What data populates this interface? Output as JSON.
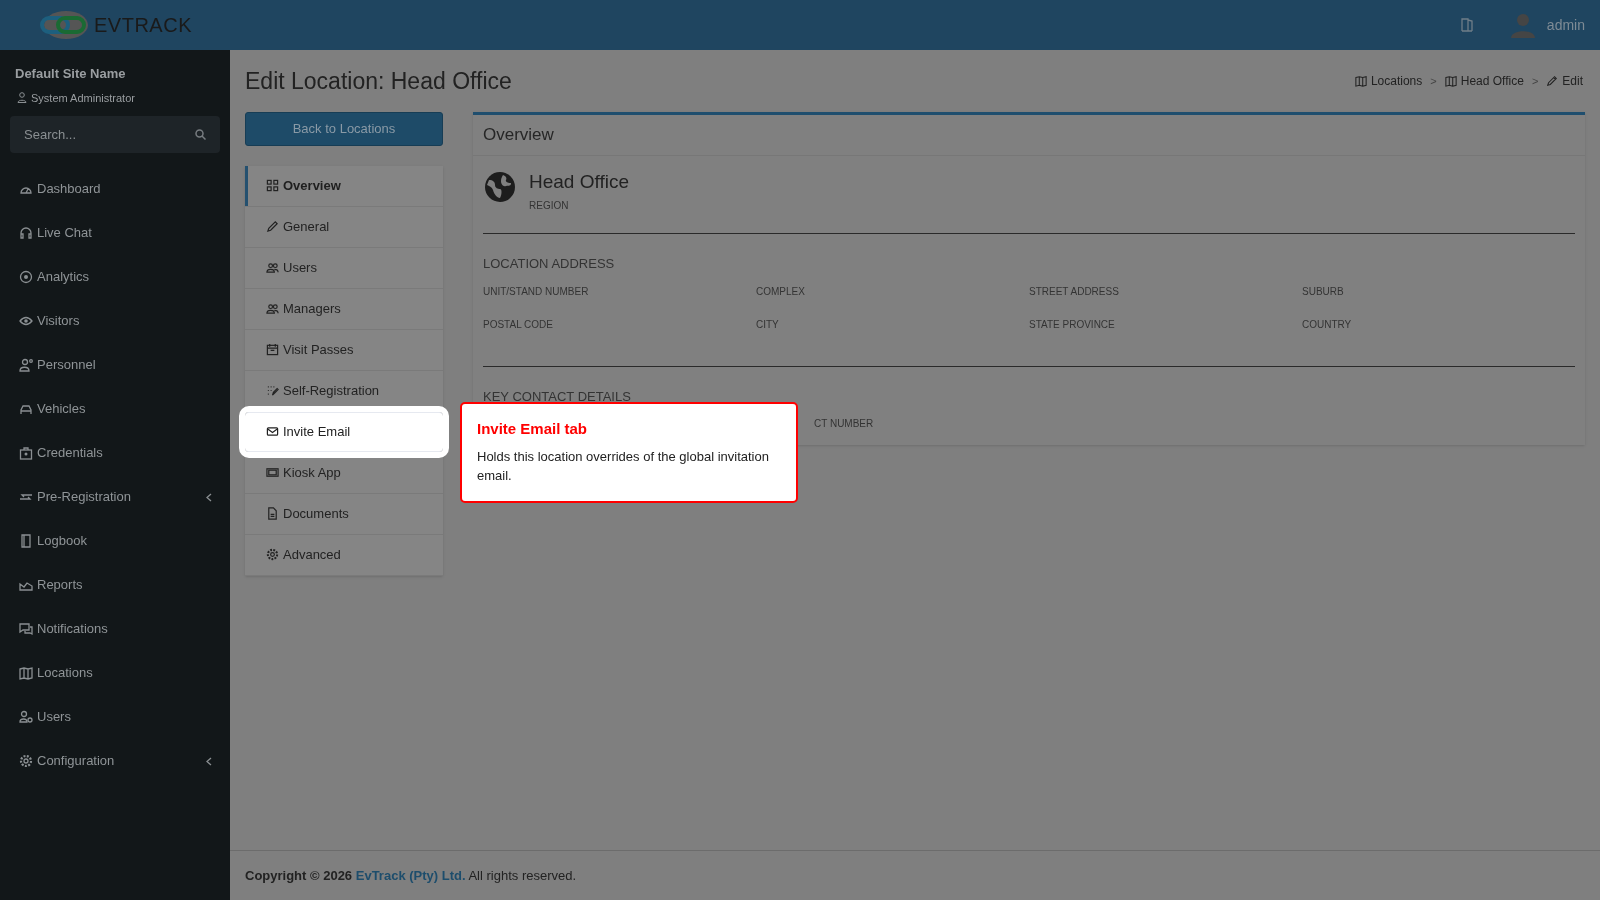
{
  "header": {
    "logo": "**EV**TRACK",
    "user": "admin"
  },
  "sidebar": {
    "site_name": "Default Site Name",
    "role": "System Administrator",
    "search_placeholder": "Search...",
    "items": [
      {
        "label": "Dashboard",
        "expandable": false
      },
      {
        "label": "Live Chat",
        "expandable": false
      },
      {
        "label": "Analytics",
        "expandable": false
      },
      {
        "label": "Visitors",
        "expandable": false
      },
      {
        "label": "Personnel",
        "expandable": false
      },
      {
        "label": "Vehicles",
        "expandable": false
      },
      {
        "label": "Credentials",
        "expandable": false
      },
      {
        "label": "Pre-Registration",
        "expandable": true
      },
      {
        "label": "Logbook",
        "expandable": false
      },
      {
        "label": "Reports",
        "expandable": false
      },
      {
        "label": "Notifications",
        "expandable": false
      },
      {
        "label": "Locations",
        "expandable": false
      },
      {
        "label": "Users",
        "expandable": false
      },
      {
        "label": "Configuration",
        "expandable": true
      }
    ]
  },
  "page": {
    "title": "Edit Location: Head Office",
    "back_button": "Back to Locations",
    "breadcrumbs": [
      {
        "label": "Locations",
        "kind": "map"
      },
      {
        "label": "Head Office",
        "kind": "map",
        "separator": ">"
      },
      {
        "label": "Edit",
        "kind": "pencil",
        "separator": ">"
      }
    ]
  },
  "tabs": [
    {
      "label": "Overview",
      "selected": true,
      "highlighted": false
    },
    {
      "label": "General",
      "selected": false,
      "highlighted": false
    },
    {
      "label": "Users",
      "selected": false,
      "highlighted": false
    },
    {
      "label": "Managers",
      "selected": false,
      "highlighted": false
    },
    {
      "label": "Visit Passes",
      "selected": false,
      "highlighted": false
    },
    {
      "label": "Self-Registration",
      "selected": false,
      "highlighted": false
    },
    {
      "label": "Invite Email",
      "selected": false,
      "highlighted": true
    },
    {
      "label": "Kiosk App",
      "selected": false,
      "highlighted": false
    },
    {
      "label": "Documents",
      "selected": false,
      "highlighted": false
    },
    {
      "label": "Advanced",
      "selected": false,
      "highlighted": false
    }
  ],
  "card": {
    "title": "Overview",
    "name": "Head Office",
    "subtitle": "REGION",
    "sections": [
      {
        "heading": "LOCATION ADDRESS",
        "fields": [
          {
            "label": "UNIT/STAND NUMBER",
            "clipped": false
          },
          {
            "label": "COMPLEX",
            "clipped": false
          },
          {
            "label": "STREET ADDRESS",
            "clipped": false
          },
          {
            "label": "SUBURB",
            "clipped": false
          },
          {
            "label": "POSTAL CODE",
            "clipped": false
          },
          {
            "label": "CITY",
            "clipped": false
          },
          {
            "label": "STATE PROVINCE",
            "clipped": false
          },
          {
            "label": "COUNTRY",
            "clipped": false
          }
        ]
      },
      {
        "heading": "KEY CONTACT DETAILS",
        "fields": [
          {
            "label": "CT NUMBER",
            "clipped": true
          }
        ]
      }
    ]
  },
  "tour": {
    "title": "Invite Email tab",
    "text": "Holds this location overrides of the global invitation email."
  },
  "footer": {
    "prefix": "Copyright © 2026",
    "link": "EvTrack (Pty) Ltd.",
    "suffix": "All rights reserved."
  }
}
